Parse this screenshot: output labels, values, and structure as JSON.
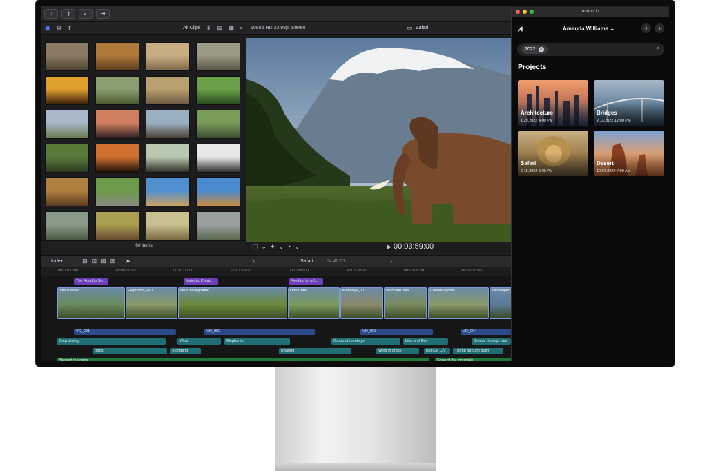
{
  "toolbar": {
    "icons": [
      "import-icon",
      "keywords-icon",
      "analyze-icon",
      "share-icon"
    ]
  },
  "browser": {
    "filter_label": "All Clips",
    "items_count": "60 items",
    "thumbs": [
      [
        "#8a7a66",
        "#4d4030"
      ],
      [
        "#b07a3a",
        "#5a3a1c"
      ],
      [
        "#c8ad82",
        "#7e6a4a"
      ],
      [
        "#9b9a86",
        "#5a5446"
      ],
      [
        "#e0a030",
        "#3a1e08"
      ],
      [
        "#8aa070",
        "#4a5a30"
      ],
      [
        "#b8a070",
        "#6a5a40"
      ],
      [
        "#6aa048",
        "#2a4a20"
      ],
      [
        "#a8b8c8",
        "#6a7a50"
      ],
      [
        "#d08060",
        "#302020"
      ],
      [
        "#9ab0c0",
        "#4a4030"
      ],
      [
        "#7a9a5a",
        "#3a4a30"
      ],
      [
        "#5a7a3a",
        "#2a3a20"
      ],
      [
        "#d07030",
        "#201008"
      ],
      [
        "#b8c8b0",
        "#303028"
      ],
      [
        "#e8e8e8",
        "#303030"
      ],
      [
        "#b08040",
        "#5a3a20"
      ],
      [
        "#6a9a4a",
        "#8a8a80"
      ],
      [
        "#5090d0",
        "#c8a060"
      ],
      [
        "#4a8ad0",
        "#c88a40"
      ],
      [
        "#8a9a88",
        "#4a5a40"
      ],
      [
        "#a8a050",
        "#6a4a30"
      ],
      [
        "#c8c090",
        "#7a6a40"
      ],
      [
        "#9aa0a0",
        "#5a6a50"
      ]
    ]
  },
  "viewer": {
    "format": "1080p HD 23.98p, Stereo",
    "title": "Safari",
    "timecode": "00:03:59:00"
  },
  "timeline": {
    "index_label": "Index",
    "title": "Safari",
    "duration": "04:40:07",
    "ruler": [
      "00:00:00:00",
      "00:00:30:00",
      "00:01:00:00",
      "00:01:30:00",
      "00:02:00:00",
      "00:02:30:00",
      "00:03:00:00",
      "00:03:30:00"
    ],
    "titles_row": [
      "The Road to Se...",
      "Majestic Creat...",
      "Feeding time f..."
    ],
    "video_clips": [
      "The Planes",
      "Elephants_001",
      "birds background",
      "Lion Cubs",
      "Monkeys_001",
      "wind and flies",
      "Cheetah prowl",
      "Kilimanjaro"
    ],
    "vo_row": [
      "VO_001",
      "VO_002",
      "VO_003",
      "VO_004"
    ],
    "sfx_row1": [
      "Jeep driving",
      "Wind",
      "Elephants",
      "Group of monkeys",
      "Lion and flies",
      "Breeze through tree"
    ],
    "sfx_row2": [
      "Birds",
      "Stomping",
      "Roaring",
      "Wind in grass",
      "Big Cat Cry",
      "Tromp through bush"
    ],
    "music_row": [
      "Blessed the rains",
      "Song of the mountain"
    ]
  },
  "alteon": {
    "window_title": "Alteon.io",
    "user_name": "Amanda Williams",
    "search_chip": "2022",
    "section_title": "Projects",
    "projects": [
      {
        "name": "Architecture",
        "date": "1.29.2022 4:00 PM"
      },
      {
        "name": "Bridges",
        "date": "2.13.2022 12:00 PM"
      },
      {
        "name": "Safari",
        "date": "6.15.2022 6:00 PM"
      },
      {
        "name": "Desert",
        "date": "10.07.2022 7:00 AM"
      }
    ]
  }
}
